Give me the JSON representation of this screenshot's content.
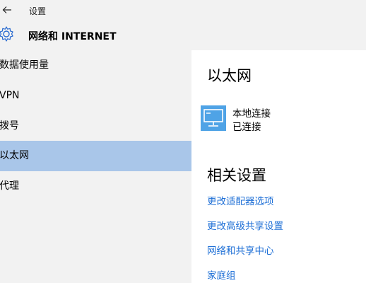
{
  "titlebar": {
    "title": "设置",
    "back_icon": "arrow-left-icon"
  },
  "header": {
    "title": "网络和 INTERNET",
    "icon": "gear-icon"
  },
  "sidebar": {
    "items": [
      {
        "label": "数据使用量",
        "selected": false
      },
      {
        "label": "VPN",
        "selected": false
      },
      {
        "label": "拨号",
        "selected": false
      },
      {
        "label": "以太网",
        "selected": true
      },
      {
        "label": "代理",
        "selected": false
      }
    ]
  },
  "main": {
    "section_title": "以太网",
    "connection": {
      "name": "本地连接",
      "status": "已连接",
      "icon": "monitor-network-icon"
    },
    "related_title": "相关设置",
    "links": [
      "更改适配器选项",
      "更改高级共享设置",
      "网络和共享中心",
      "家庭组"
    ]
  },
  "colors": {
    "accent": "#1e6fd6",
    "selected_bg": "#a9c6e9",
    "panel_bg": "#f2f2f2",
    "icon_tile": "#4fa3e6"
  }
}
